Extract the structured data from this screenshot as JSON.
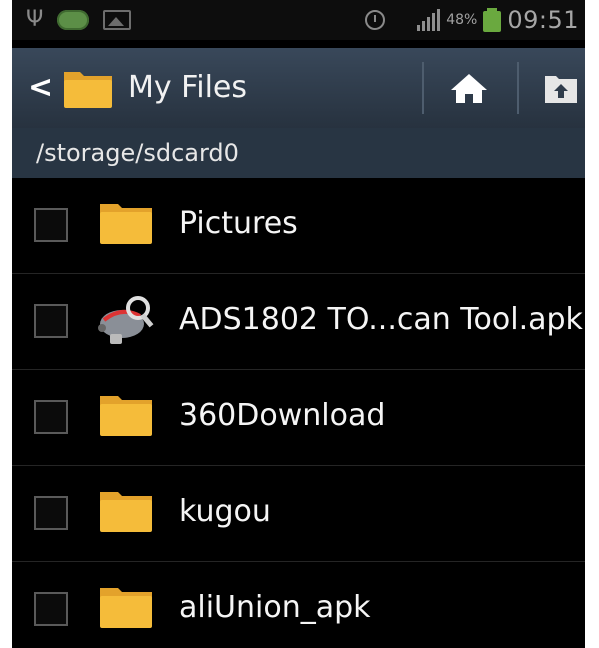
{
  "status_bar": {
    "battery_percent": "48%",
    "clock": "09:51",
    "icons": [
      "usb-icon",
      "app-notification-icon",
      "image-icon",
      "alarm-icon",
      "signal-icon",
      "battery-charging-icon"
    ]
  },
  "action_bar": {
    "title": "My Files",
    "up_icon": "chevron-left-icon",
    "home_icon": "home-icon",
    "up_folder_icon": "folder-up-icon"
  },
  "path": "/storage/sdcard0",
  "files": [
    {
      "name": "Pictures",
      "type": "folder",
      "checked": false
    },
    {
      "name": "ADS1802 TO...can Tool.apk",
      "type": "apk",
      "checked": false
    },
    {
      "name": "360Download",
      "type": "folder",
      "checked": false
    },
    {
      "name": "kugou",
      "type": "folder",
      "checked": false
    },
    {
      "name": "aliUnion_apk",
      "type": "folder",
      "checked": false
    }
  ],
  "colors": {
    "folder": "#f5bc3a",
    "action_bar": "#2f3c4b",
    "path_bar": "#283543",
    "background": "#000000"
  }
}
